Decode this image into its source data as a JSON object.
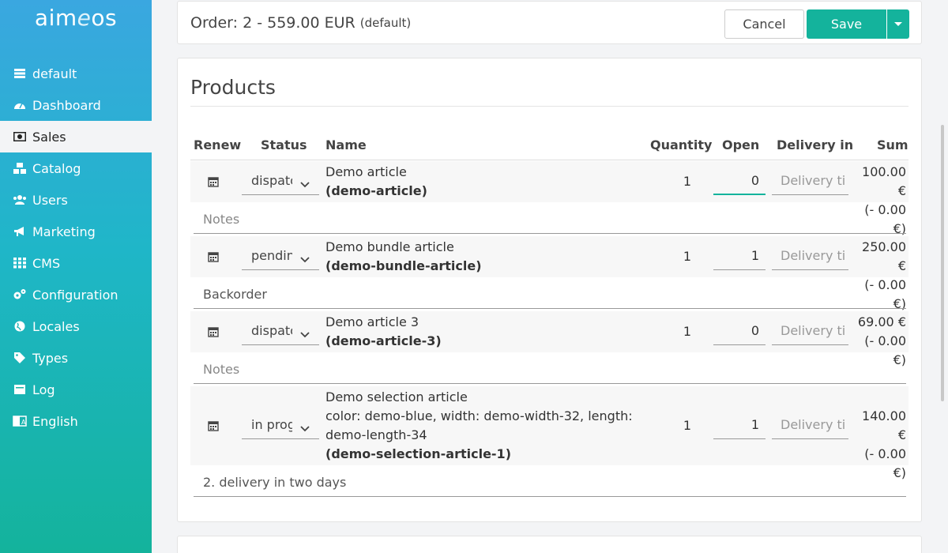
{
  "sidebar": {
    "logo": {
      "pre": "aim",
      "e": "e",
      "post": "os"
    },
    "items": [
      {
        "label": "default",
        "icon": "database-icon"
      },
      {
        "label": "Dashboard",
        "icon": "dashboard-icon"
      },
      {
        "label": "Sales",
        "icon": "money-icon"
      },
      {
        "label": "Catalog",
        "icon": "cubes-icon"
      },
      {
        "label": "Users",
        "icon": "users-icon"
      },
      {
        "label": "Marketing",
        "icon": "bullhorn-icon"
      },
      {
        "label": "CMS",
        "icon": "grid-icon"
      },
      {
        "label": "Configuration",
        "icon": "gears-icon"
      },
      {
        "label": "Locales",
        "icon": "globe-icon"
      },
      {
        "label": "Types",
        "icon": "tag-icon"
      },
      {
        "label": "Log",
        "icon": "log-icon"
      },
      {
        "label": "English",
        "icon": "language-icon"
      }
    ],
    "active_index": 2
  },
  "header": {
    "title": "Order: 2 - 559.00 EUR",
    "subtitle": "(default)",
    "cancel_label": "Cancel",
    "save_label": "Save"
  },
  "products": {
    "title": "Products",
    "columns": {
      "renew": "Renew",
      "status": "Status",
      "name": "Name",
      "quantity": "Quantity",
      "open": "Open",
      "delivery": "Delivery in",
      "sum": "Sum"
    },
    "delivery_placeholder": "Delivery ti",
    "rows": [
      {
        "status": "dispatched",
        "name": "Demo article",
        "attrs": "",
        "code": "(demo-article)",
        "quantity": "1",
        "open": "0",
        "price": "100.00 €",
        "rebate": "(- 0.00 €)",
        "note": "Notes",
        "note_is_placeholder": true
      },
      {
        "status": "pending",
        "name": "Demo bundle article",
        "attrs": "",
        "code": "(demo-bundle-article)",
        "quantity": "1",
        "open": "1",
        "price": "250.00 €",
        "rebate": "(- 0.00 €)",
        "note": "Backorder",
        "note_is_placeholder": false
      },
      {
        "status": "dispatched",
        "name": "Demo article 3",
        "attrs": "",
        "code": "(demo-article-3)",
        "quantity": "1",
        "open": "0",
        "price": "69.00 €",
        "rebate": "(- 0.00 €)",
        "note": "Notes",
        "note_is_placeholder": true
      },
      {
        "status": "in progress",
        "name": "Demo selection article",
        "attrs_line1": "color: demo-blue, width: demo-width-32, length:",
        "attrs_line2": "demo-length-34",
        "code": "(demo-selection-article-1)",
        "quantity": "1",
        "open": "1",
        "price": "140.00 €",
        "rebate": "(- 0.00 €)",
        "note": "2. delivery in two days",
        "note_is_placeholder": false
      }
    ]
  },
  "colors": {
    "accent": "#14b39c",
    "sidebar_top": "#3aa7e0",
    "sidebar_bottom": "#14b39c"
  }
}
